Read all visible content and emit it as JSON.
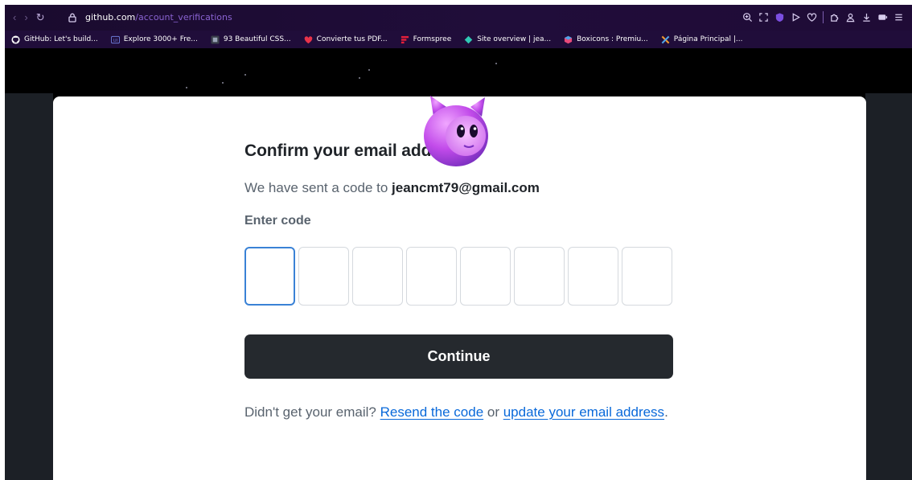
{
  "browser": {
    "nav": {
      "back": "‹",
      "forward": "›",
      "reload": "↻"
    },
    "url_host": "github.com",
    "url_path": "/account_verifications",
    "bookmarks": [
      {
        "label": "GitHub: Let's build...",
        "icon": "github-icon",
        "color": "#ffffff"
      },
      {
        "label": "Explore 3000+ Fre...",
        "icon": "ui-icon",
        "color": "#6b7bd6"
      },
      {
        "label": "93 Beautiful CSS...",
        "icon": "css-icon",
        "color": "#9aa4b8"
      },
      {
        "label": "Convierte tus PDF...",
        "icon": "pdf-heart-icon",
        "color": "#e8334a"
      },
      {
        "label": "Formspree",
        "icon": "formspree-icon",
        "color": "#e5203a"
      },
      {
        "label": "Site overview | jea...",
        "icon": "netlify-icon",
        "color": "#30c8b4"
      },
      {
        "label": "Boxicons : Premiu...",
        "icon": "boxicons-icon",
        "color": "#e84a7a"
      },
      {
        "label": "Página Principal |...",
        "icon": "x-logo-icon",
        "color": "#f29a2e"
      }
    ],
    "toolbar_icons": [
      "zoom-icon",
      "screenshot-icon",
      "shield-extension-icon",
      "play-icon",
      "heart-icon",
      "puzzle-icon",
      "profile-icon",
      "download-icon",
      "battery-icon",
      "menu-icon"
    ],
    "accent_colors": {
      "toolbar": "#1a0b2e",
      "url_path": "#8a63d2"
    }
  },
  "page": {
    "title": "Confirm your email address",
    "sent_prefix": "We have sent a code to ",
    "email": "jeancmt79@gmail.com",
    "code_label": "Enter code",
    "code_digits": [
      "",
      "",
      "",
      "",
      "",
      "",
      "",
      ""
    ],
    "continue_label": "Continue",
    "help_prefix": "Didn't get your email? ",
    "resend_link": "Resend the code",
    "help_middle": " or ",
    "update_link": "update your email address",
    "help_suffix": ".",
    "colors": {
      "button": "#25292e",
      "link": "#0969da",
      "focus": "#3a82d6",
      "text": "#1f2328",
      "muted": "#59636e"
    }
  }
}
